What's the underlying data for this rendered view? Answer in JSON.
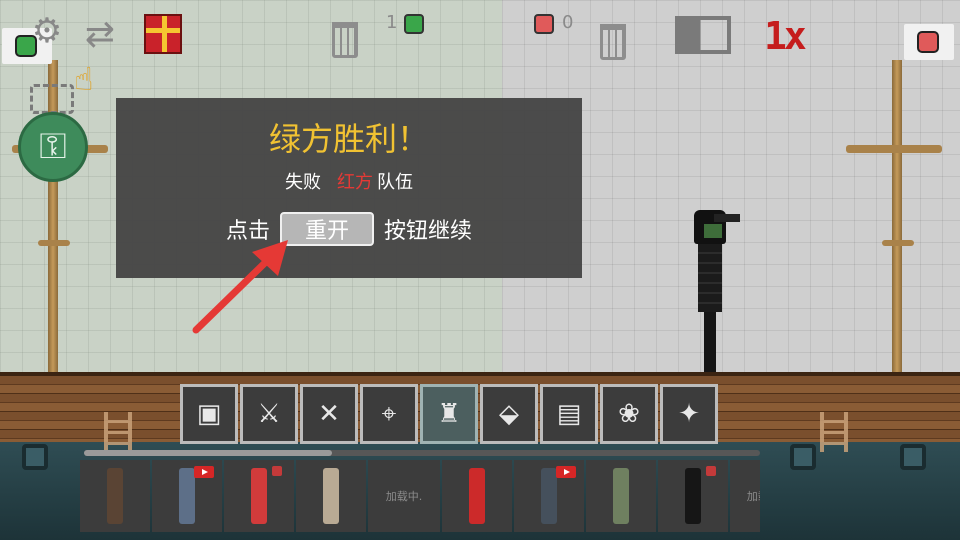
{
  "hud": {
    "green_score": "1",
    "red_score": "0",
    "speed_label": "1x"
  },
  "dialog": {
    "title": "绿方胜利！",
    "lose_prefix": "失败",
    "lose_team": "红方",
    "lose_suffix": "队伍",
    "tap_prefix": "点击",
    "restart_label": "重开",
    "tap_suffix": "按钮继续"
  },
  "categories": [
    {
      "name": "cat-characters",
      "icon": "▣"
    },
    {
      "name": "cat-melee",
      "icon": "⚔"
    },
    {
      "name": "cat-tools",
      "icon": "✕"
    },
    {
      "name": "cat-firearms",
      "icon": "⌖"
    },
    {
      "name": "cat-armor",
      "icon": "♜"
    },
    {
      "name": "cat-explosives",
      "icon": "⬙"
    },
    {
      "name": "cat-machines",
      "icon": "▤"
    },
    {
      "name": "cat-animals",
      "icon": "❀"
    },
    {
      "name": "cat-magic",
      "icon": "✦"
    }
  ],
  "items": {
    "loading_1": "加载中.",
    "loading_2": "加载中."
  },
  "colors": {
    "green_team": "#3aa64a",
    "red_team": "#e05a5a",
    "title_yellow": "#f1c232",
    "arrow_red": "#e53935"
  }
}
